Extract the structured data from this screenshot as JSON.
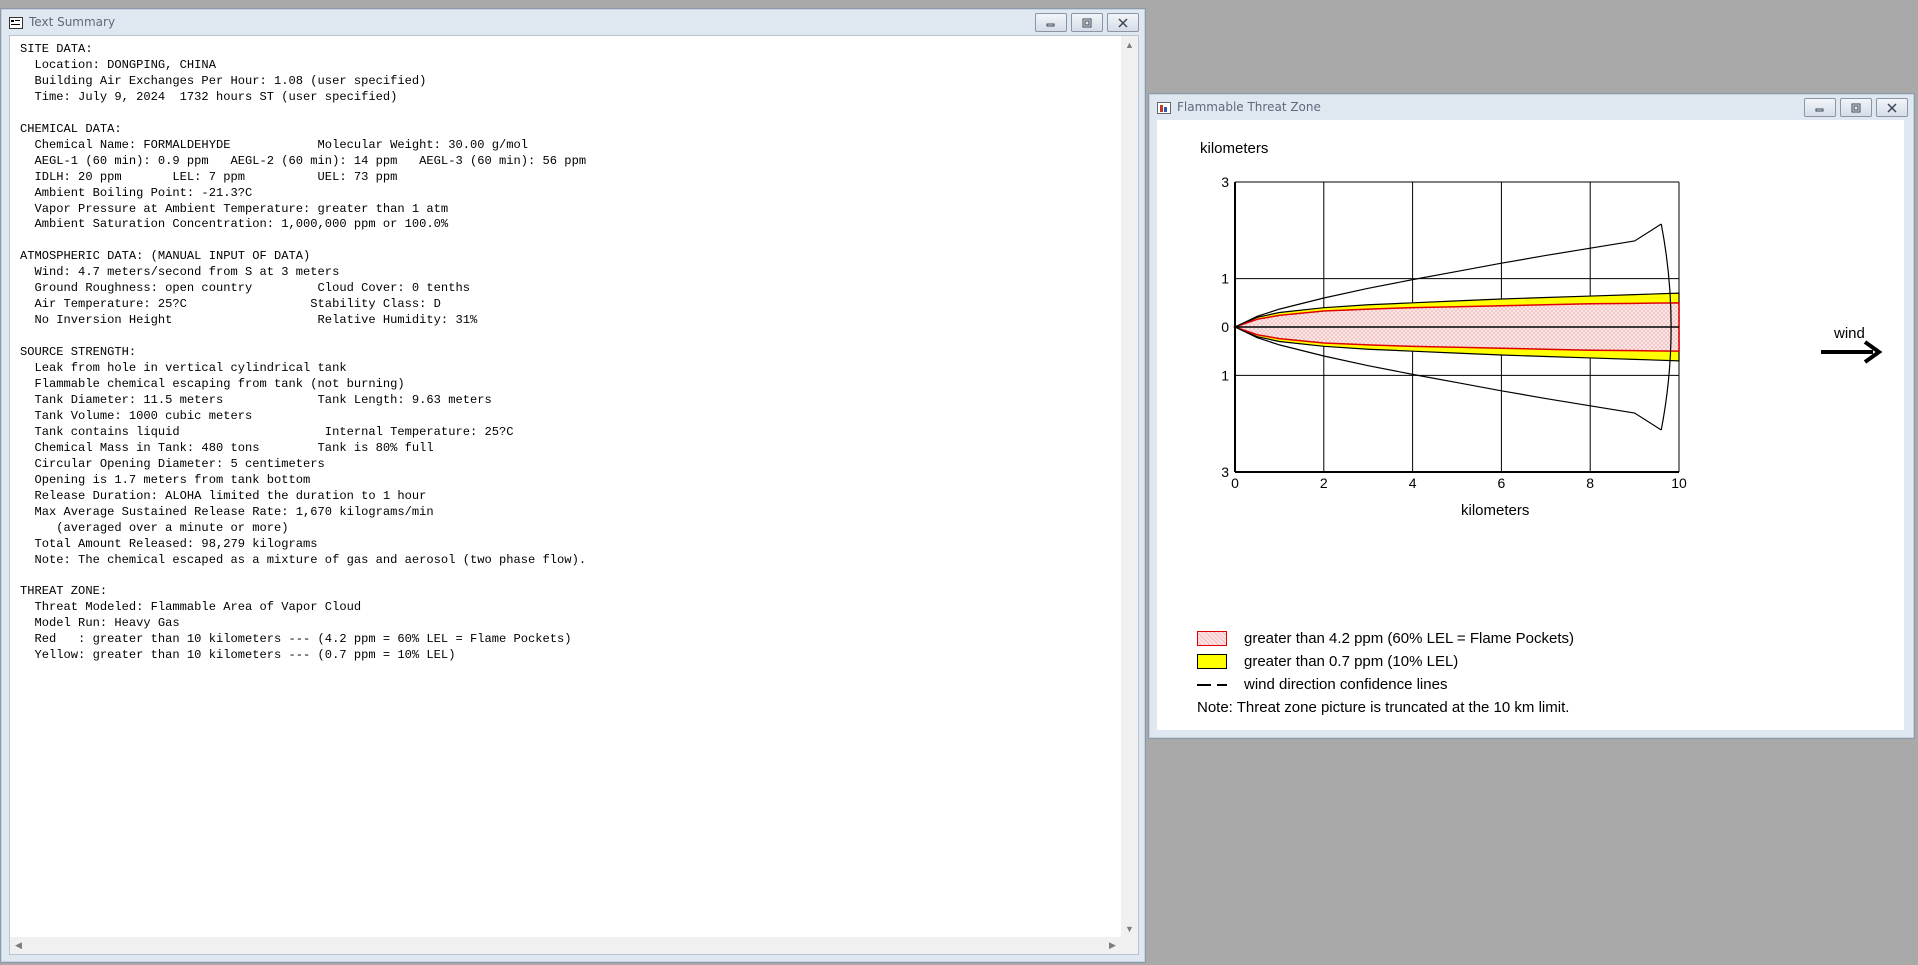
{
  "text_window": {
    "title": "Text Summary",
    "lines": [
      "SITE DATA:",
      "  Location: DONGPING, CHINA",
      "  Building Air Exchanges Per Hour: 1.08 (user specified)",
      "  Time: July 9, 2024  1732 hours ST (user specified)",
      "",
      "CHEMICAL DATA:",
      "  Chemical Name: FORMALDEHYDE            Molecular Weight: 30.00 g/mol",
      "  AEGL-1 (60 min): 0.9 ppm   AEGL-2 (60 min): 14 ppm   AEGL-3 (60 min): 56 ppm",
      "  IDLH: 20 ppm       LEL: 7 ppm          UEL: 73 ppm",
      "  Ambient Boiling Point: -21.3?C",
      "  Vapor Pressure at Ambient Temperature: greater than 1 atm",
      "  Ambient Saturation Concentration: 1,000,000 ppm or 100.0%",
      "",
      "ATMOSPHERIC DATA: (MANUAL INPUT OF DATA)",
      "  Wind: 4.7 meters/second from S at 3 meters",
      "  Ground Roughness: open country         Cloud Cover: 0 tenths",
      "  Air Temperature: 25?C                 Stability Class: D",
      "  No Inversion Height                    Relative Humidity: 31%",
      "",
      "SOURCE STRENGTH:",
      "  Leak from hole in vertical cylindrical tank",
      "  Flammable chemical escaping from tank (not burning)",
      "  Tank Diameter: 11.5 meters             Tank Length: 9.63 meters",
      "  Tank Volume: 1000 cubic meters",
      "  Tank contains liquid                    Internal Temperature: 25?C",
      "  Chemical Mass in Tank: 480 tons        Tank is 80% full",
      "  Circular Opening Diameter: 5 centimeters",
      "  Opening is 1.7 meters from tank bottom",
      "  Release Duration: ALOHA limited the duration to 1 hour",
      "  Max Average Sustained Release Rate: 1,670 kilograms/min",
      "     (averaged over a minute or more)",
      "  Total Amount Released: 98,279 kilograms",
      "  Note: The chemical escaped as a mixture of gas and aerosol (two phase flow).",
      "",
      "THREAT ZONE:",
      "  Threat Modeled: Flammable Area of Vapor Cloud",
      "  Model Run: Heavy Gas",
      "  Red   : greater than 10 kilometers --- (4.2 ppm = 60% LEL = Flame Pockets)",
      "  Yellow: greater than 10 kilometers --- (0.7 ppm = 10% LEL)"
    ]
  },
  "threat_window": {
    "title": "Flammable Threat Zone",
    "y_axis_label": "kilometers",
    "x_axis_label": "kilometers",
    "wind_label": "wind",
    "legend": [
      {
        "label": "greater than 4.2 ppm (60% LEL = Flame Pockets)",
        "color": "#ff0000",
        "fill": "#fbe3e3"
      },
      {
        "label": "greater than 0.7 ppm (10% LEL)",
        "color": "#000000",
        "fill": "#ffff00"
      },
      {
        "label": "wind direction confidence lines",
        "color": "#000000"
      }
    ],
    "note": "Note: Threat zone picture is truncated at the 10 km limit."
  },
  "chart_data": {
    "type": "area",
    "xlabel": "kilometers",
    "ylabel": "kilometers",
    "xlim": [
      0,
      10
    ],
    "ylim": [
      -3,
      3
    ],
    "x_ticks": [
      "0",
      "2",
      "4",
      "6",
      "8",
      "10"
    ],
    "y_ticks": [
      "3",
      "1",
      "0",
      "1",
      "3"
    ],
    "y_tick_values": [
      3,
      1,
      0,
      -1,
      -3
    ],
    "grid": true,
    "series": [
      {
        "name": "greater than 0.7 ppm (10% LEL)",
        "color": "#ffff00",
        "x": [
          0,
          0.5,
          1,
          2,
          3,
          4,
          5,
          6,
          7,
          8,
          9,
          10
        ],
        "half_width": [
          0,
          0.2,
          0.3,
          0.4,
          0.46,
          0.5,
          0.54,
          0.58,
          0.61,
          0.64,
          0.67,
          0.7
        ]
      },
      {
        "name": "greater than 4.2 ppm (60% LEL = Flame Pockets)",
        "color": "#ff0000",
        "x": [
          0,
          0.5,
          1,
          2,
          3,
          4,
          5,
          6,
          7,
          8,
          9,
          10
        ],
        "half_width": [
          0,
          0.16,
          0.24,
          0.33,
          0.37,
          0.4,
          0.42,
          0.44,
          0.46,
          0.48,
          0.49,
          0.5
        ]
      },
      {
        "name": "wind direction confidence lines",
        "color": "#000000",
        "x": [
          0,
          0.5,
          1,
          2,
          3,
          4,
          5,
          6,
          7,
          8,
          9,
          9.7
        ],
        "half_width": [
          0,
          0.22,
          0.37,
          0.6,
          0.8,
          0.98,
          1.15,
          1.32,
          1.48,
          1.63,
          1.78,
          2.22
        ]
      }
    ]
  }
}
